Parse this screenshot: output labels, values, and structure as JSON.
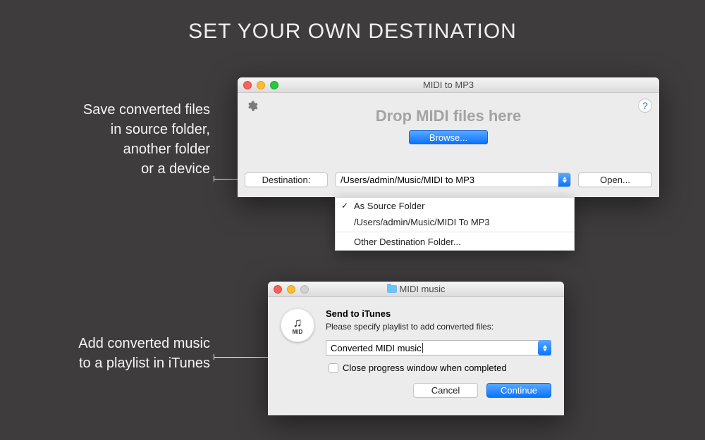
{
  "heading": "SET YOUR OWN DESTINATION",
  "caption1": "Save converted files\nin source folder,\nanother folder\nor a device",
  "caption2": "Add converted music\nto a playlist in iTunes",
  "window1": {
    "title": "MIDI to MP3",
    "drop_text": "Drop MIDI files here",
    "browse": "Browse...",
    "dest_label": "Destination:",
    "dest_path": "/Users/admin/Music/MIDI to MP3",
    "open": "Open..."
  },
  "dropdown": {
    "item_source": "As Source Folder",
    "item_path": "/Users/admin/Music/MIDI To MP3",
    "item_other": "Other Destination Folder..."
  },
  "window2": {
    "title": "MIDI music",
    "icon_label": "MID",
    "sheet_title": "Send to iTunes",
    "sheet_sub": "Please specify playlist to add converted files:",
    "playlist_value": "Converted MIDI music",
    "checkbox_label": "Close progress window when completed",
    "cancel": "Cancel",
    "continue": "Continue"
  },
  "help_glyph": "?"
}
